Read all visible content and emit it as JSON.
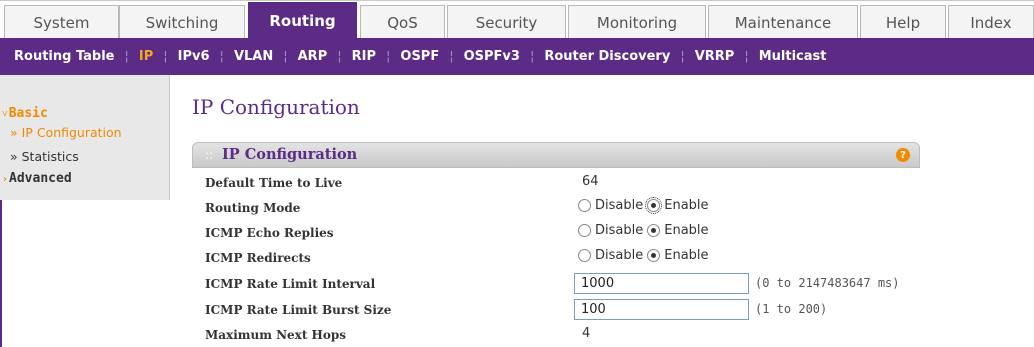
{
  "tabs": [
    {
      "label": "System"
    },
    {
      "label": "Switching"
    },
    {
      "label": "Routing"
    },
    {
      "label": "QoS"
    },
    {
      "label": "Security"
    },
    {
      "label": "Monitoring"
    },
    {
      "label": "Maintenance"
    },
    {
      "label": "Help"
    },
    {
      "label": "Index"
    }
  ],
  "subnav": [
    {
      "label": "Routing Table"
    },
    {
      "label": "IP"
    },
    {
      "label": "IPv6"
    },
    {
      "label": "VLAN"
    },
    {
      "label": "ARP"
    },
    {
      "label": "RIP"
    },
    {
      "label": "OSPF"
    },
    {
      "label": "OSPFv3"
    },
    {
      "label": "Router Discovery"
    },
    {
      "label": "VRRP"
    },
    {
      "label": "Multicast"
    }
  ],
  "sidebar": {
    "basic": "Basic",
    "ip_configuration": "» IP Configuration",
    "statistics": "» Statistics",
    "advanced": "Advanced"
  },
  "page_title": "IP Configuration",
  "panel": {
    "title": "IP Configuration",
    "help_icon": "?"
  },
  "fields": {
    "ttl_label": "Default Time to Live",
    "ttl_value": "64",
    "routing_mode_label": "Routing Mode",
    "icmp_echo_label": "ICMP Echo Replies",
    "icmp_redirects_label": "ICMP Redirects",
    "rate_interval_label": "ICMP Rate Limit Interval",
    "rate_interval_value": "1000",
    "rate_interval_hint": "(0 to 2147483647 ms)",
    "burst_label": "ICMP Rate Limit Burst Size",
    "burst_value": "100",
    "burst_hint": "(1 to 200)",
    "max_hops_label": "Maximum Next Hops",
    "max_hops_value": "4"
  },
  "radio_labels": {
    "disable": "Disable",
    "enable": "Enable"
  },
  "colors": {
    "brand": "#5b2b86",
    "accent": "#f08a00"
  }
}
